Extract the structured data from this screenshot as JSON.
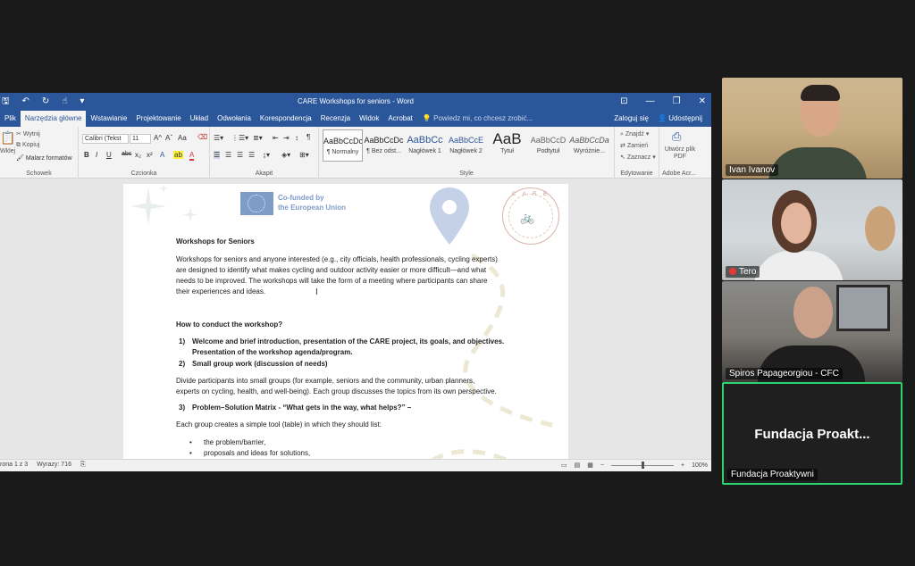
{
  "word": {
    "title": "CARE  Workshops for seniors - Word",
    "qat_icons": [
      "save-icon",
      "undo-icon",
      "redo-icon",
      "touch-mode-icon",
      "customize-icon"
    ],
    "window_controls": [
      "ribbon-display-icon",
      "minimize-icon",
      "restore-icon",
      "close-icon"
    ],
    "tabs": [
      "Plik",
      "Narzędzia główne",
      "Wstawianie",
      "Projektowanie",
      "Układ",
      "Odwołania",
      "Korespondencja",
      "Recenzja",
      "Widok",
      "Acrobat"
    ],
    "active_tab": "Narzędzia główne",
    "tell_me": "Powiedz mi, co chcesz zrobić...",
    "sign_in": "Zaloguj się",
    "share": "Udostępnij",
    "ribbon": {
      "clipboard": {
        "paste": "Wklej",
        "cut": "Wytnij",
        "copy": "Kopiuj",
        "format_painter": "Malarz formatów",
        "label": "Schowek"
      },
      "font": {
        "font_name": "Calibri (Tekst",
        "font_size": "11",
        "grow": "A^",
        "shrink": "Aˇ",
        "case": "Aa",
        "bold": "B",
        "italic": "I",
        "underline": "U",
        "strike": "abc",
        "sub": "x₂",
        "sup": "x²",
        "label": "Czcionka"
      },
      "paragraph": {
        "label": "Akapit"
      },
      "styles": {
        "items": [
          {
            "preview": "AaBbCcDc",
            "name": "¶ Normalny"
          },
          {
            "preview": "AaBbCcDc",
            "name": "¶ Bez odst..."
          },
          {
            "preview": "AaBbCc",
            "name": "Nagłówek 1"
          },
          {
            "preview": "AaBbCcE",
            "name": "Nagłówek 2"
          },
          {
            "preview": "AaB",
            "name": "Tytuł"
          },
          {
            "preview": "AaBbCcD",
            "name": "Podtytuł"
          },
          {
            "preview": "AaBbCcDa",
            "name": "Wyróżnie..."
          }
        ],
        "label": "Style"
      },
      "editing": {
        "find": "Znajdź",
        "replace": "Zamień",
        "select": "Zaznacz",
        "label": "Edytowanie"
      },
      "adobe": {
        "create_pdf": "Utwórz plik PDF",
        "label": "Adobe Acr..."
      }
    },
    "document": {
      "eu_line1": "Co-funded by",
      "eu_line2": "the European Union",
      "seal_text": "C A R E",
      "heading": "Workshops for Seniors",
      "intro_lines": [
        "Workshops for seniors and anyone interested (e.g., city officials, health professionals, cycling experts)",
        "are designed to identify what makes cycling and outdoor activity easier or more difficult—and what",
        "needs to be improved. The workshops will take the form of a meeting where participants can share",
        "their experiences and ideas."
      ],
      "how_heading": "How to conduct the workshop?",
      "step1_num": "1)",
      "step1_lines": [
        "Welcome and brief introduction, presentation of the CARE project, its goals, and objectives.",
        "Presentation of the workshop agenda/program."
      ],
      "step2_num": "2)",
      "step2": "Small group work (discussion of needs)",
      "groups_lines": [
        "Divide participants into small groups (for example, seniors and the community, urban planners,",
        "experts on cycling, health, and well-being). Each group discusses the topics from its own perspective."
      ],
      "step3_num": "3)",
      "step3": "Problem–Solution Matrix - “What gets in the way, what helps?” –",
      "tool_line": "Each group creates a simple tool (table) in which they should list:",
      "bullets": [
        "the problem/barrier,",
        "proposals and ideas for solutions,"
      ]
    },
    "status": {
      "page": "rona 1 z 3",
      "words": "Wyrazy: 716",
      "zoom": "100%",
      "zoom_fraction": 0.5
    }
  },
  "participants": [
    {
      "name": "Ivan Ivanov"
    },
    {
      "name": "Tero",
      "muted": true
    },
    {
      "name": "Spiros Papageorgiou - CFC"
    },
    {
      "name": "Fundacja Proaktywni",
      "display": "Fundacja Proakt..."
    }
  ],
  "colors": {
    "word_blue": "#2b579a",
    "active_speaker": "#2dd36f",
    "eu_blue": "#7f9bc8"
  }
}
